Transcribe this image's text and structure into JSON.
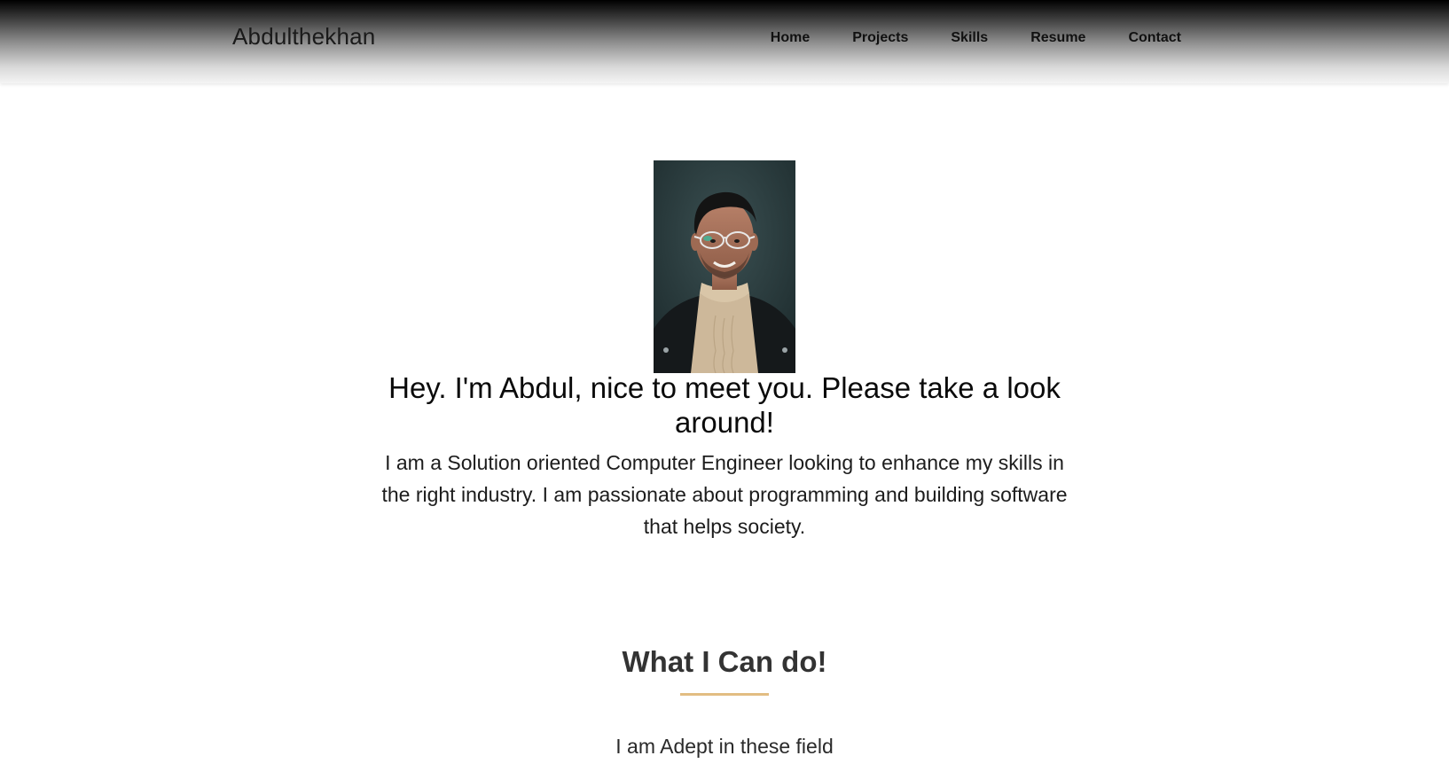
{
  "header": {
    "brand": "Abdulthekhan",
    "nav": [
      {
        "label": "Home"
      },
      {
        "label": "Projects"
      },
      {
        "label": "Skills"
      },
      {
        "label": "Resume"
      },
      {
        "label": "Contact"
      }
    ]
  },
  "hero": {
    "headline": "Hey. I'm Abdul, nice to meet you. Please take a look around!",
    "intro": "I am a Solution oriented Computer Engineer looking to enhance my skills in the right industry. I am passionate about programming and building software that helps society."
  },
  "skills_section": {
    "title": "What I Can do!",
    "subtitle": "I am Adept in these field",
    "accent_color": "#e2bd82"
  }
}
